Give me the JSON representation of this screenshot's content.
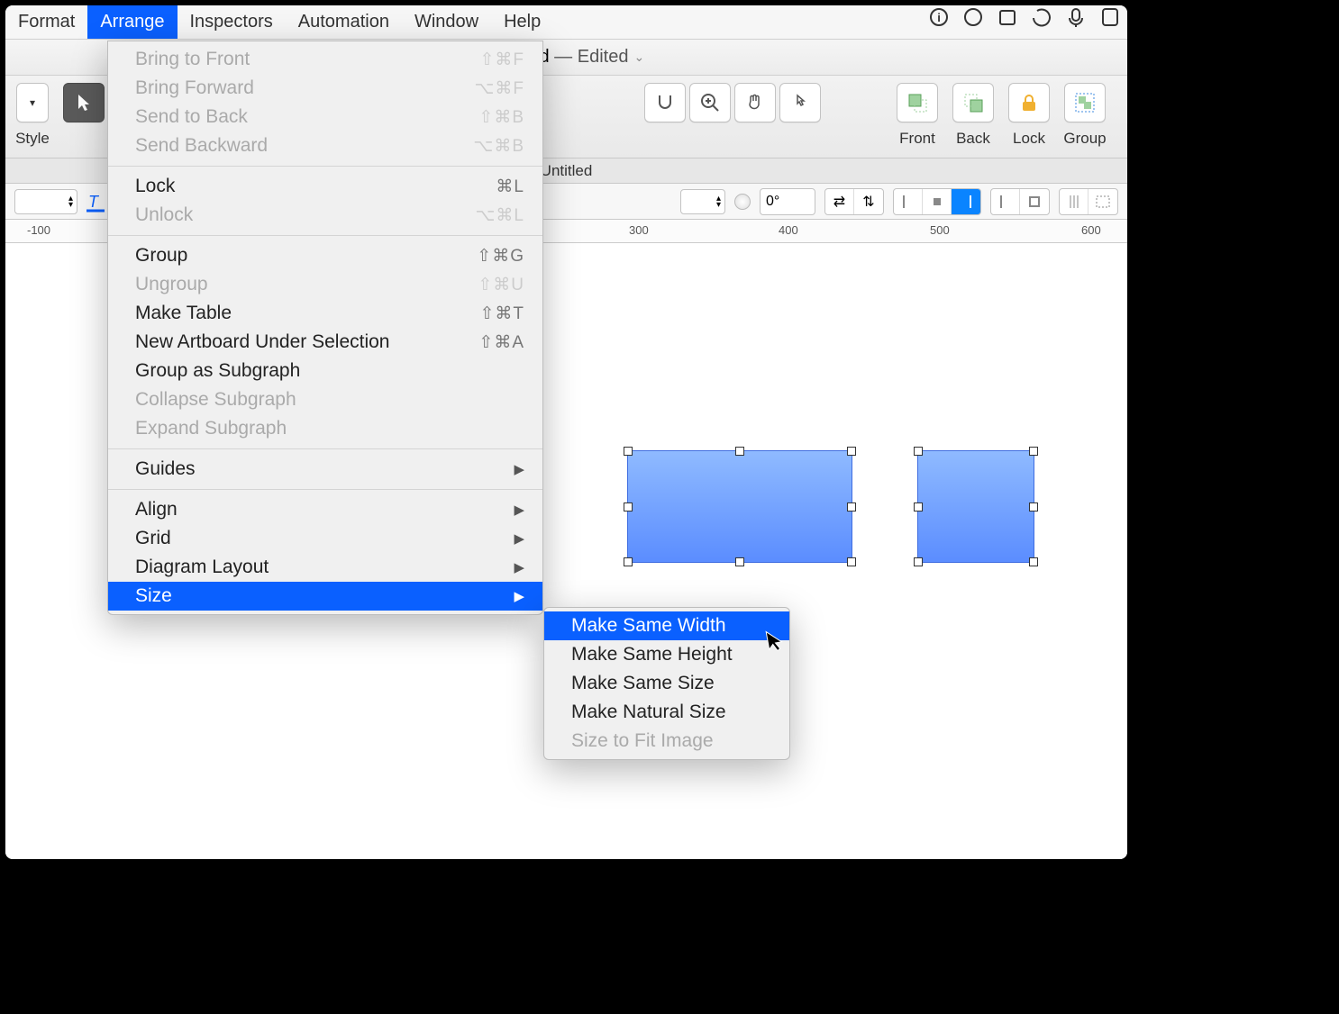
{
  "menubar": {
    "items": [
      "Format",
      "Arrange",
      "Inspectors",
      "Automation",
      "Window",
      "Help"
    ],
    "active_index": 1
  },
  "title": {
    "name": "Untitled",
    "edited": "Edited"
  },
  "toolbar": {
    "style_label": "Style",
    "front_label": "Front",
    "back_label": "Back",
    "lock_label": "Lock",
    "group_label": "Group"
  },
  "canvas_tab": "Untitled",
  "rotation": "0°",
  "ruler": [
    "-100",
    "300",
    "400",
    "500",
    "600"
  ],
  "menu": {
    "sections": [
      [
        {
          "label": "Bring to Front",
          "short": "⇧⌘F",
          "disabled": true
        },
        {
          "label": "Bring Forward",
          "short": "⌥⌘F",
          "disabled": true
        },
        {
          "label": "Send to Back",
          "short": "⇧⌘B",
          "disabled": true
        },
        {
          "label": "Send Backward",
          "short": "⌥⌘B",
          "disabled": true
        }
      ],
      [
        {
          "label": "Lock",
          "short": "⌘L"
        },
        {
          "label": "Unlock",
          "short": "⌥⌘L",
          "disabled": true
        }
      ],
      [
        {
          "label": "Group",
          "short": "⇧⌘G"
        },
        {
          "label": "Ungroup",
          "short": "⇧⌘U",
          "disabled": true
        },
        {
          "label": "Make Table",
          "short": "⇧⌘T"
        },
        {
          "label": "New Artboard Under Selection",
          "short": "⇧⌘A"
        },
        {
          "label": "Group as Subgraph"
        },
        {
          "label": "Collapse Subgraph",
          "disabled": true
        },
        {
          "label": "Expand Subgraph",
          "disabled": true
        }
      ],
      [
        {
          "label": "Guides",
          "sub": true
        }
      ],
      [
        {
          "label": "Align",
          "sub": true
        },
        {
          "label": "Grid",
          "sub": true
        },
        {
          "label": "Diagram Layout",
          "sub": true
        },
        {
          "label": "Size",
          "sub": true,
          "selected": true
        }
      ]
    ]
  },
  "submenu": {
    "items": [
      {
        "label": "Make Same Width",
        "selected": true
      },
      {
        "label": "Make Same Height"
      },
      {
        "label": "Make Same Size"
      },
      {
        "label": "Make Natural Size"
      },
      {
        "label": "Size to Fit Image",
        "disabled": true
      }
    ]
  }
}
